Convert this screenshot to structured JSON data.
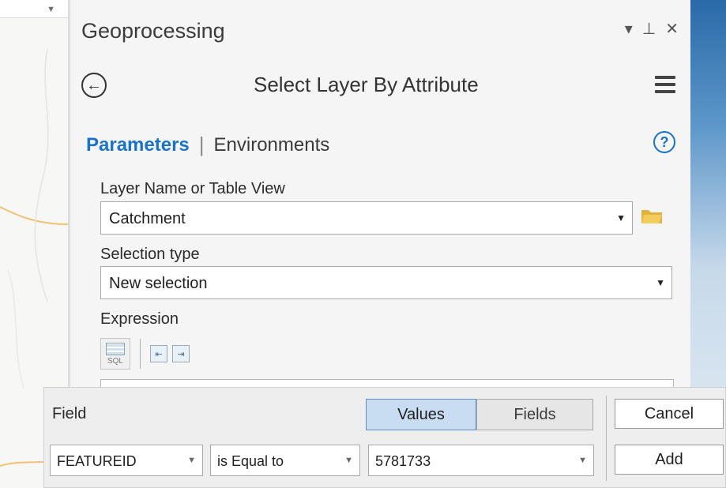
{
  "pane": {
    "title": "Geoprocessing",
    "controls": {
      "dropdown": "▾",
      "pin": "⊥",
      "close": "✕"
    },
    "tool_title": "Select Layer By Attribute"
  },
  "tabs": {
    "active": "Parameters",
    "separator": "|",
    "inactive": "Environments",
    "help": "?"
  },
  "params": {
    "layer_label": "Layer Name or Table View",
    "layer_value": "Catchment",
    "selection_label": "Selection type",
    "selection_value": "New selection",
    "expression_label": "Expression",
    "sql_label": "SQL"
  },
  "clause": {
    "field_label": "Field",
    "values_tab": "Values",
    "fields_tab": "Fields",
    "cancel": "Cancel",
    "add": "Add",
    "field_value": "FEATUREID",
    "operator_value": "is Equal to",
    "value_value": "5781733"
  },
  "colors": {
    "accent": "#1a73c7",
    "folder": "#e0b43c",
    "active_toggle": "#c8ddf1"
  },
  "icons": [
    "back-arrow-icon",
    "hamburger-menu-icon",
    "help-icon",
    "folder-icon",
    "sql-icon",
    "indent-left-icon",
    "indent-right-icon",
    "chevron-down-icon",
    "pin-icon",
    "close-icon"
  ]
}
